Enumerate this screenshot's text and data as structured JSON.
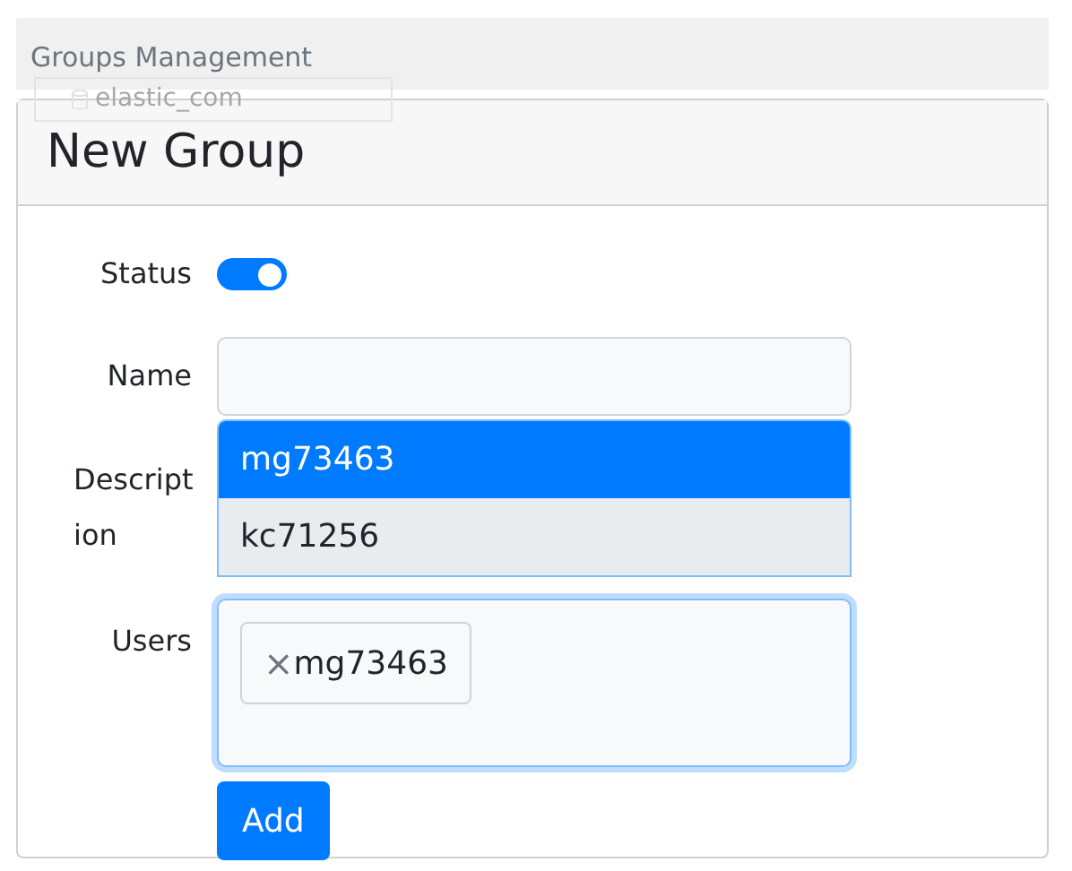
{
  "header": {
    "title": "Groups Management"
  },
  "overlay_chip": {
    "text": "elastic_com"
  },
  "card": {
    "title": "New Group",
    "status": {
      "label": "Status",
      "on": true
    },
    "name": {
      "label": "Name"
    },
    "description": {
      "label": "Description"
    },
    "users": {
      "label": "Users",
      "tags": [
        {
          "text": "mg73463",
          "remove": "×"
        }
      ]
    },
    "dropdown": {
      "options": [
        {
          "text": "mg73463",
          "selected": true,
          "highlighted": false
        },
        {
          "text": "kc71256",
          "selected": false,
          "highlighted": true
        }
      ]
    },
    "submit": "Add"
  }
}
